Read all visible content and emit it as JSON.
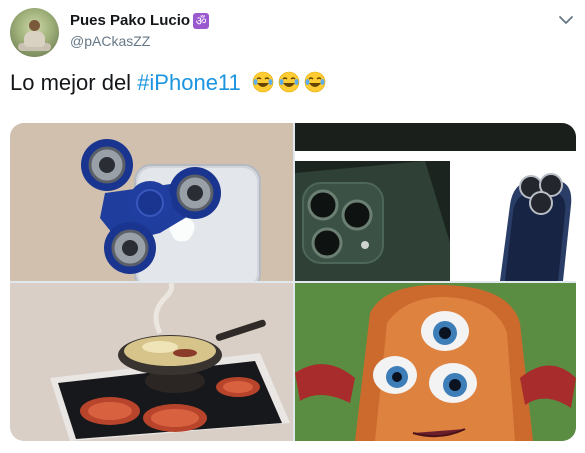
{
  "author": {
    "name": "Pues Pako Lucio",
    "badge": "ॐ",
    "handle": "@pACkasZZ"
  },
  "tweet": {
    "text_before": "Lo mejor del ",
    "hashtag": "#iPhone11",
    "emojis": [
      "tears-of-joy-emoji",
      "tears-of-joy-emoji",
      "tears-of-joy-emoji"
    ]
  },
  "icons": {
    "menu": "chevron-down-icon"
  },
  "colors": {
    "link": "#1b95e0",
    "secondary_text": "#657786",
    "primary_text": "#14171a",
    "badge": "#9b59d0"
  },
  "media": {
    "images": [
      "fidget-spinner-on-iphone-image",
      "iphone-11-pro-camera-and-shaver-image",
      "induction-cooktop-pan-image",
      "three-eyed-cartoon-character-image"
    ]
  }
}
